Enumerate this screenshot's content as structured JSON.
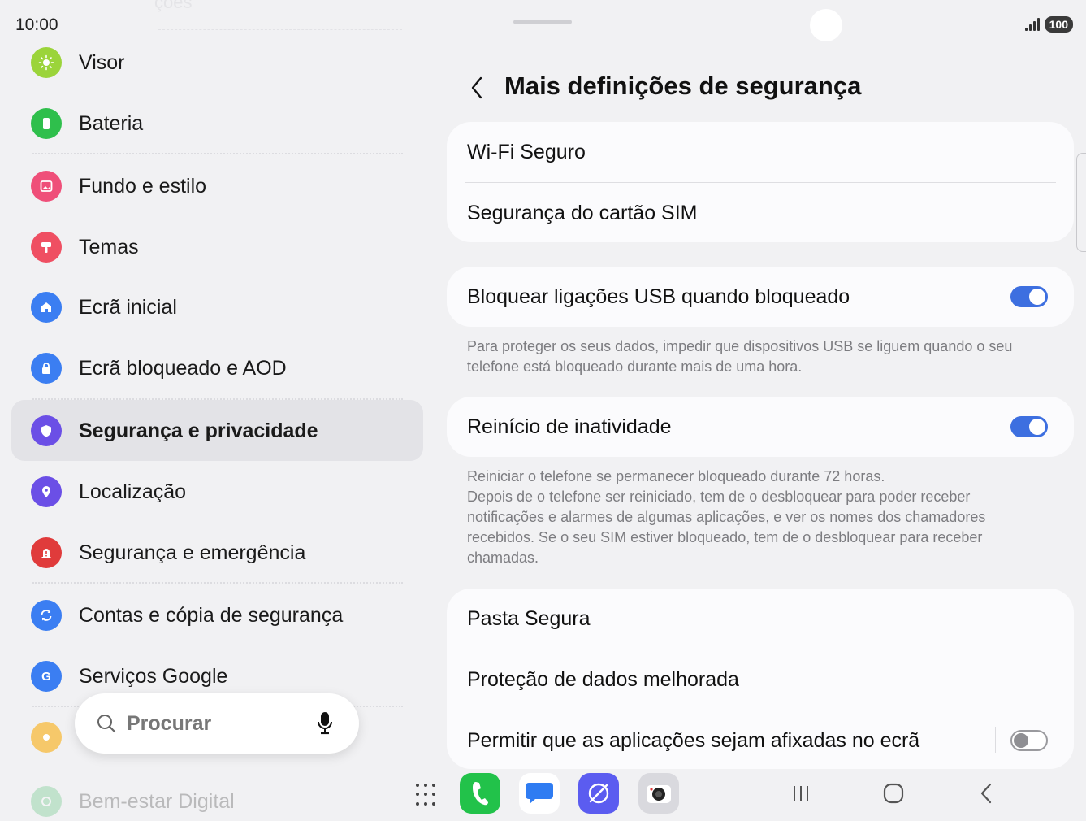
{
  "status_bar": {
    "time": "10:00",
    "battery": "100"
  },
  "left_menu": {
    "items": [
      {
        "label": "Visor",
        "icon": "sun-icon",
        "color": "#9bd43a"
      },
      {
        "label": "Bateria",
        "icon": "battery-icon",
        "color": "#2fbf4c"
      },
      {
        "label": "Fundo e estilo",
        "icon": "image-icon",
        "color": "#ef4f79"
      },
      {
        "label": "Temas",
        "icon": "paintbrush-icon",
        "color": "#ef4f62"
      },
      {
        "label": "Ecrã inicial",
        "icon": "home-icon",
        "color": "#3b7ef2"
      },
      {
        "label": "Ecrã bloqueado e AOD",
        "icon": "lock-icon",
        "color": "#3b7ef2"
      },
      {
        "label": "Segurança e privacidade",
        "icon": "shield-icon",
        "color": "#6b4fe6",
        "active": true
      },
      {
        "label": "Localização",
        "icon": "location-pin-icon",
        "color": "#6b4fe6"
      },
      {
        "label": "Segurança e emergência",
        "icon": "emergency-icon",
        "color": "#e03b3b"
      },
      {
        "label": "Contas e cópia de segurança",
        "icon": "sync-icon",
        "color": "#3b7ef2"
      },
      {
        "label": "Serviços Google",
        "icon": "google-icon",
        "color": "#3b7ef2"
      },
      {
        "label": "Bem-estar Digital",
        "icon": "wellbeing-icon",
        "color": "#34b65a"
      }
    ]
  },
  "search": {
    "placeholder": "Procurar"
  },
  "page": {
    "title": "Mais definições de segurança"
  },
  "cards": {
    "card1": {
      "wifi": "Wi-Fi Seguro",
      "sim": "Segurança do cartão SIM"
    },
    "usb": {
      "label": "Bloquear ligações USB quando bloqueado",
      "on": true,
      "desc_line1": "Para proteger os seus dados, impedir que dispositivos USB se liguem quando o seu",
      "desc_line2": "telefone está bloqueado durante mais de uma hora."
    },
    "restart": {
      "label": "Reinício de inatividade",
      "on": true,
      "desc_line1": "Reiniciar o telefone se permanecer bloqueado durante 72 horas.",
      "desc_line2": "Depois de o telefone ser reiniciado, tem de o desbloquear para poder receber",
      "desc_line3": "notificações e alarmes de algumas aplicações, e ver os nomes dos chamadores",
      "desc_line4": "recebidos. Se o seu SIM estiver bloqueado, tem de o desbloquear para receber",
      "desc_line5": "chamadas."
    },
    "card4": {
      "secure_folder": "Pasta Segura",
      "data_protection": "Proteção de dados melhorada",
      "pin_apps": "Permitir que as aplicações sejam afixadas no ecrã",
      "pin_apps_on": false
    }
  },
  "taskbar": {
    "apps": [
      "phone-icon",
      "messages-icon",
      "internet-icon",
      "camera-icon"
    ],
    "colors": {
      "phone": "#22c24a",
      "messages": "#2f7cf2",
      "internet": "#5b5cf0",
      "camera": "#d9d9de"
    }
  }
}
